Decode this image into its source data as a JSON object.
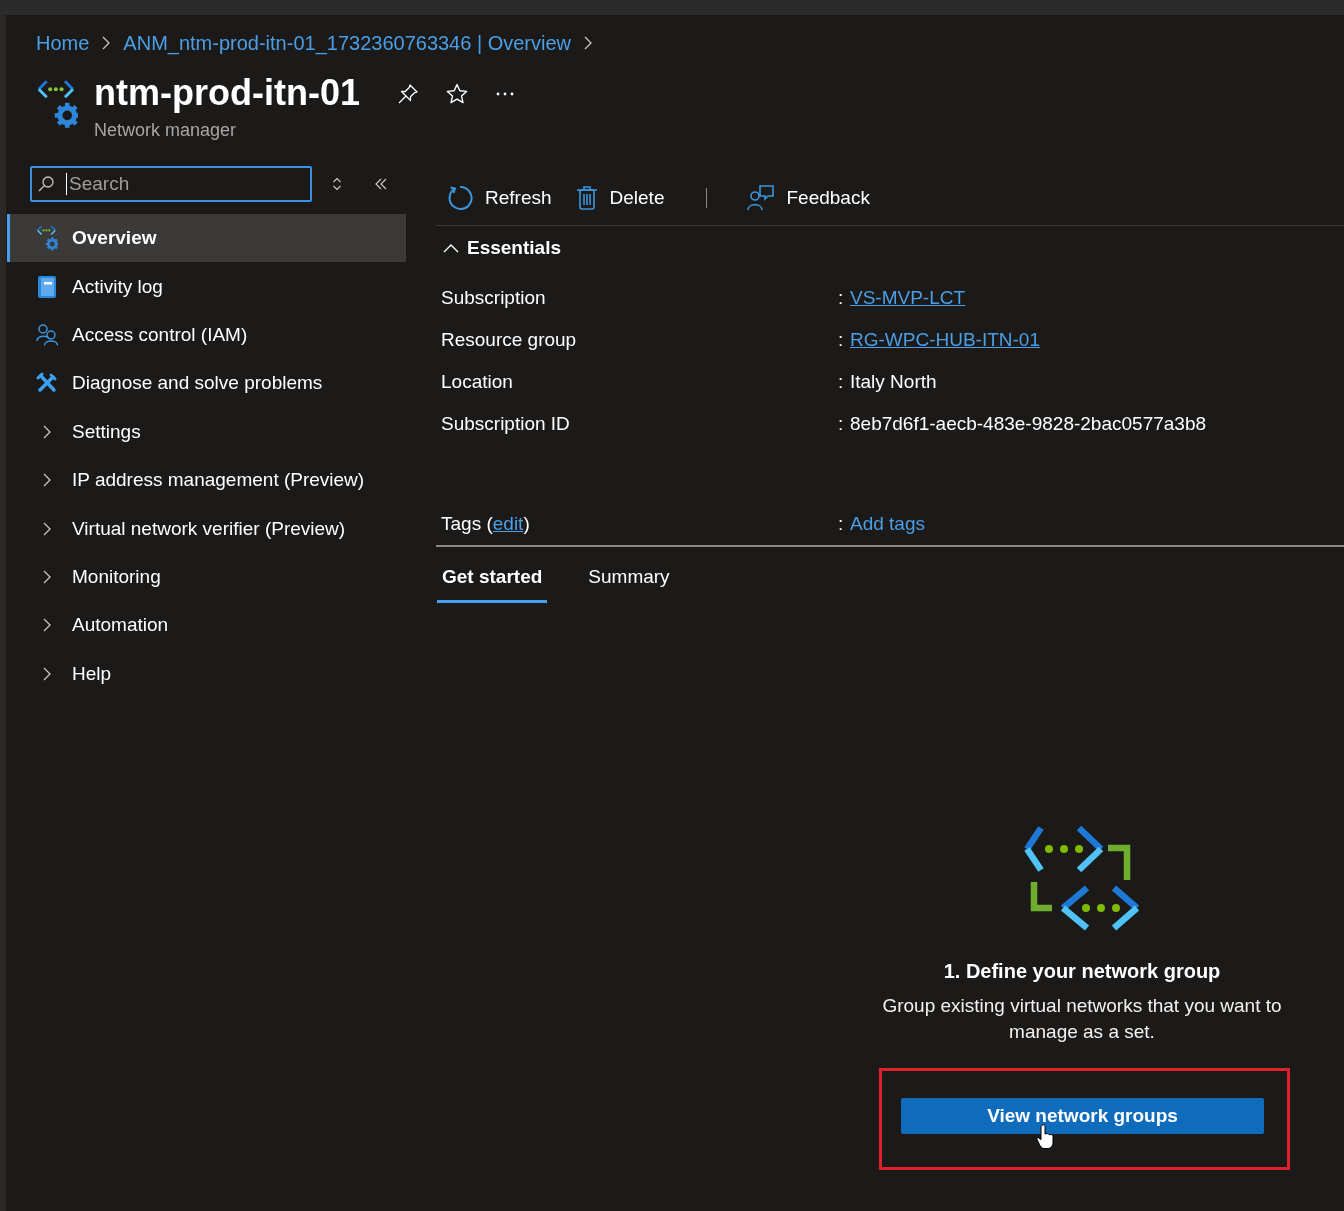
{
  "breadcrumb": [
    {
      "label": "Home"
    },
    {
      "label": "ANM_ntm-prod-itn-01_1732360763346 | Overview"
    }
  ],
  "resource": {
    "title": "ntm-prod-itn-01",
    "subtitle": "Network manager"
  },
  "sidebar": {
    "search": {
      "placeholder": "Search",
      "focused": true
    },
    "items": [
      {
        "kind": "page",
        "label": "Overview",
        "selected": true
      },
      {
        "kind": "page",
        "label": "Activity log",
        "selected": false
      },
      {
        "kind": "page",
        "label": "Access control (IAM)",
        "selected": false
      },
      {
        "kind": "page",
        "label": "Diagnose and solve problems",
        "selected": false
      },
      {
        "kind": "group",
        "label": "Settings",
        "selected": false,
        "expanded": false
      },
      {
        "kind": "group",
        "label": "IP address management (Preview)",
        "selected": false,
        "expanded": false
      },
      {
        "kind": "group",
        "label": "Virtual network verifier (Preview)",
        "selected": false,
        "expanded": false
      },
      {
        "kind": "group",
        "label": "Monitoring",
        "selected": false,
        "expanded": false
      },
      {
        "kind": "group",
        "label": "Automation",
        "selected": false,
        "expanded": false
      },
      {
        "kind": "group",
        "label": "Help",
        "selected": false,
        "expanded": false
      }
    ]
  },
  "toolbar": [
    {
      "kind": "button",
      "label": "Refresh"
    },
    {
      "kind": "button",
      "label": "Delete"
    },
    {
      "kind": "separator"
    },
    {
      "kind": "button",
      "label": "Feedback"
    }
  ],
  "essentials": {
    "title": "Essentials",
    "expanded": true,
    "properties": [
      {
        "label": "Subscription",
        "separator": ":",
        "value": "VS-MVP-LCT",
        "kind": "link"
      },
      {
        "label": "Resource group",
        "separator": ":",
        "value": "RG-WPC-HUB-ITN-01",
        "kind": "link"
      },
      {
        "label": "Location",
        "separator": ":",
        "value": "Italy North",
        "kind": "text"
      },
      {
        "label": "Subscription ID",
        "separator": ":",
        "value": "8eb7d6f1-aecb-483e-9828-2bac0577a3b8",
        "kind": "text"
      }
    ],
    "tags": {
      "label": "Tags (",
      "edit_link": "edit",
      "label_end": ")",
      "separator": ":",
      "value": "Add tags"
    }
  },
  "tabs": [
    {
      "label": "Get started",
      "selected": true
    },
    {
      "label": "Summary",
      "selected": false
    }
  ],
  "get_started": {
    "cards": [
      {
        "title": "1. Define your network group",
        "description": "Group existing virtual networks that you want to manage as a set.",
        "button": {
          "label": "View network groups",
          "highlighted": true,
          "hovered": true
        }
      }
    ]
  }
}
